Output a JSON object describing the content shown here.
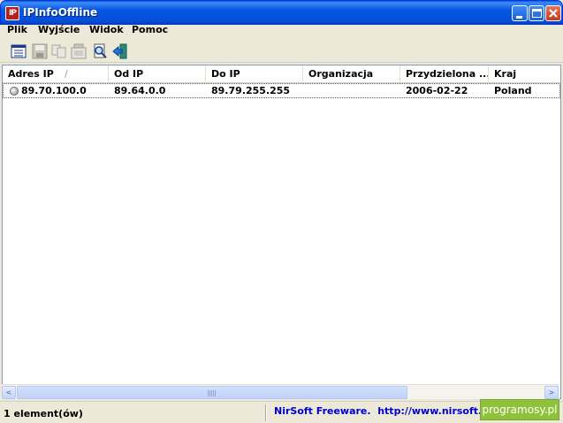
{
  "window": {
    "title": "IPInfoOffline",
    "icon_text": "IP"
  },
  "menu": {
    "items": [
      "Plik",
      "Wyjście",
      "Widok",
      "Pomoc"
    ]
  },
  "toolbar": {
    "icons": [
      "properties-icon",
      "save-icon",
      "copy-icon",
      "html-report-icon",
      "find-icon",
      "exit-icon"
    ]
  },
  "table": {
    "columns": [
      "Adres IP",
      "Od IP",
      "Do IP",
      "Organizacja",
      "Przydzielona ...",
      "Kraj"
    ],
    "sort_indicator": "/",
    "rows": [
      {
        "address": "89.70.100.0",
        "from": "89.64.0.0",
        "to": "89.79.255.255",
        "organization": "",
        "allocated": "2006-02-22",
        "country": "Poland"
      }
    ]
  },
  "scrollbar": {
    "left_arrow": "<",
    "right_arrow": ">"
  },
  "status": {
    "count": "1 element(ów)",
    "link": "NirSoft Freeware.  http://www.nirsoft.net",
    "watermark": "programosy.pl"
  },
  "colors": {
    "titlebar": "#0554e3",
    "link": "#0000cc",
    "watermark_bg": "#8fc13a"
  }
}
